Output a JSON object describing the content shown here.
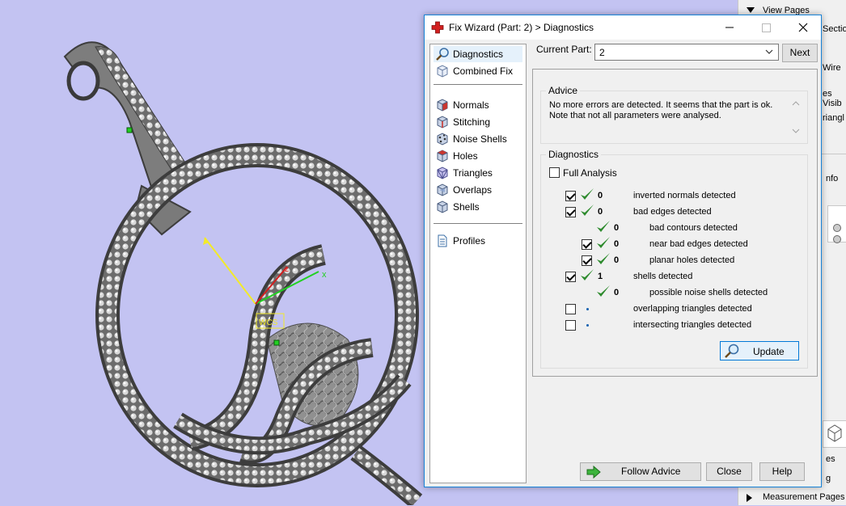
{
  "viewport": {
    "axis_x_label": "x",
    "axis_z_label": "z",
    "wcs_label": "WCS"
  },
  "side_panel": {
    "view_pages": "View Pages",
    "section": "Section",
    "wire": "Wire",
    "es_visible": "es Visib",
    "triangle": "riangl",
    "info": "nfo",
    "es": "es",
    "g": "g",
    "measurement_pages": "Measurement Pages"
  },
  "dialog": {
    "title": "Fix Wizard (Part: 2) > Diagnostics",
    "nav": {
      "items": [
        {
          "label": "Diagnostics",
          "icon": "magnifier-icon"
        },
        {
          "label": "Combined Fix",
          "icon": "cube-icon"
        },
        {
          "label": "Normals",
          "icon": "normals-cube-icon"
        },
        {
          "label": "Stitching",
          "icon": "stitching-cube-icon"
        },
        {
          "label": "Noise Shells",
          "icon": "noise-shells-icon"
        },
        {
          "label": "Holes",
          "icon": "holes-cube-icon"
        },
        {
          "label": "Triangles",
          "icon": "triangles-cube-icon"
        },
        {
          "label": "Overlaps",
          "icon": "overlaps-cube-icon"
        },
        {
          "label": "Shells",
          "icon": "shells-cube-icon"
        },
        {
          "label": "Profiles",
          "icon": "document-icon"
        }
      ]
    },
    "current_part": {
      "label": "Current Part:",
      "value": "2",
      "next_label": "Next"
    },
    "advice": {
      "title": "Advice",
      "text_line1": "No more errors are detected. It seems that the part is ok.",
      "text_line2": "Note that not all parameters were analysed."
    },
    "diagnostics": {
      "title": "Diagnostics",
      "full_analysis_label": "Full Analysis",
      "rows": [
        {
          "count": "0",
          "label": "inverted normals detected"
        },
        {
          "count": "0",
          "label": "bad edges detected"
        },
        {
          "count": "0",
          "label": "bad contours detected"
        },
        {
          "count": "0",
          "label": "near bad edges detected"
        },
        {
          "count": "0",
          "label": "planar holes detected"
        },
        {
          "count": "1",
          "label": "shells detected"
        },
        {
          "count": "0",
          "label": "possible noise shells detected"
        },
        {
          "count": "",
          "label": "overlapping triangles detected"
        },
        {
          "count": "",
          "label": "intersecting triangles detected"
        }
      ],
      "update_label": "Update"
    },
    "footer": {
      "follow_advice": "Follow Advice",
      "close": "Close",
      "help": "Help"
    },
    "colors": {
      "accent": "#0078d7",
      "check_green": "#2e8b2e",
      "viewport_bg": "#c3c3f2"
    }
  }
}
